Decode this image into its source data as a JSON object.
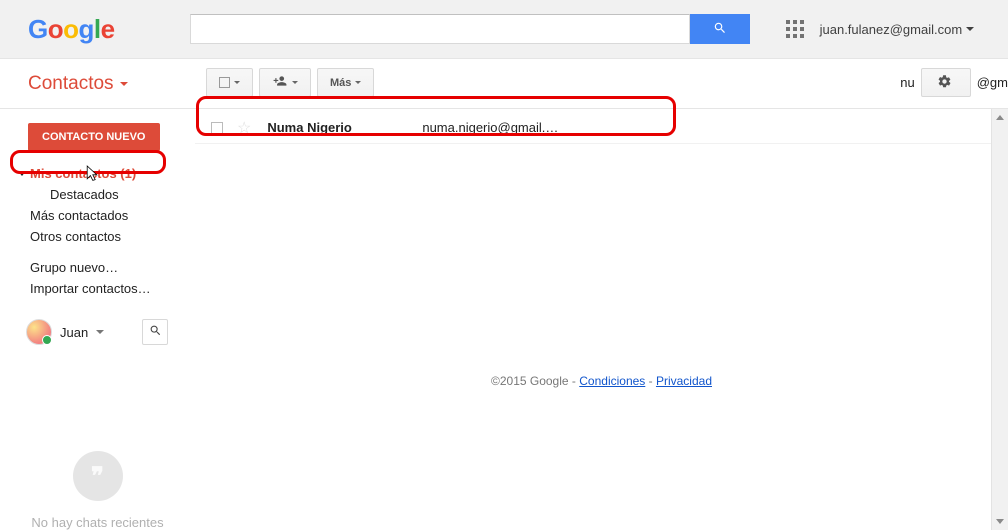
{
  "header": {
    "logo_letters": [
      "G",
      "o",
      "o",
      "g",
      "l",
      "e"
    ],
    "search_placeholder": "",
    "account_email": "juan.fulanez@gmail.com"
  },
  "subbar": {
    "app_title": "Contactos",
    "toolbar": {
      "more_label": "Más"
    },
    "right_truncated_left": "nu",
    "right_truncated_right": "@gm"
  },
  "sidebar": {
    "new_contact_label": "CONTACTO NUEVO",
    "nav": {
      "my_contacts": "Mis contactos (1)",
      "starred": "Destacados",
      "most_contacted": "Más contactados",
      "other_contacts": "Otros contactos",
      "new_group": "Grupo nuevo…",
      "import_contacts": "Importar contactos…"
    },
    "user_name": "Juan",
    "hangouts_text": "No hay chats recientes"
  },
  "contacts": [
    {
      "name": "Numa Nigerio",
      "email": "numa.nigerio@gmail.…"
    }
  ],
  "footer": {
    "copyright": "©2015 Google",
    "sep": " - ",
    "terms": "Condiciones",
    "privacy": "Privacidad"
  }
}
